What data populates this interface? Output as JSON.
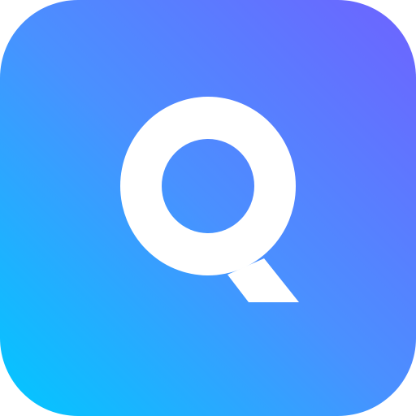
{
  "app_icon": {
    "letter": "Q",
    "icon_name": "q-letter-icon",
    "colors": {
      "gradient_start": "#00c8ff",
      "gradient_mid": "#4a90ff",
      "gradient_end": "#6e63ff",
      "glyph": "#ffffff"
    }
  }
}
